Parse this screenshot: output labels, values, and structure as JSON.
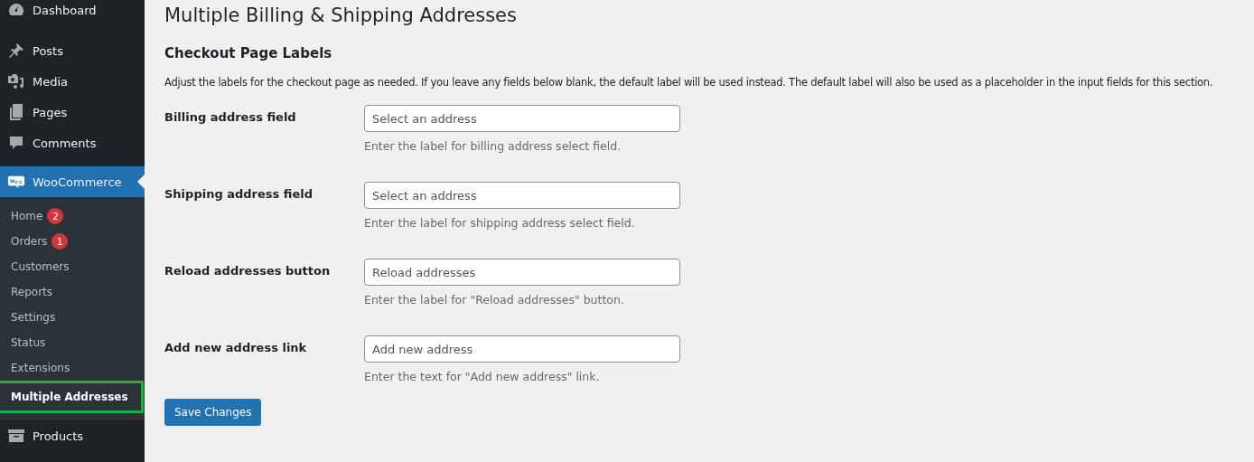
{
  "sidebar": {
    "items": [
      {
        "label": "Dashboard",
        "selected": false
      },
      {
        "label": "Posts",
        "selected": false
      },
      {
        "label": "Media",
        "selected": false
      },
      {
        "label": "Pages",
        "selected": false
      },
      {
        "label": "Comments",
        "selected": false
      },
      {
        "label": "WooCommerce",
        "selected": true,
        "children": [
          {
            "label": "Home",
            "badge": "2",
            "selected": false
          },
          {
            "label": "Orders",
            "badge": "1",
            "selected": false
          },
          {
            "label": "Customers",
            "selected": false
          },
          {
            "label": "Reports",
            "selected": false
          },
          {
            "label": "Settings",
            "selected": false
          },
          {
            "label": "Status",
            "selected": false
          },
          {
            "label": "Extensions",
            "selected": false
          },
          {
            "label": "Multiple Addresses",
            "selected": true
          }
        ]
      },
      {
        "label": "Products",
        "selected": false
      }
    ]
  },
  "page": {
    "title": "Multiple Billing & Shipping Addresses",
    "section": "Checkout Page Labels",
    "description": "Adjust the labels for the checkout page as needed. If you leave any fields below blank, the default label will be used instead. The default label will also be used as a placeholder in the input fields for this section.",
    "fields": [
      {
        "label": "Billing address field",
        "placeholder": "Select an address",
        "hint": "Enter the label for billing address select field."
      },
      {
        "label": "Shipping address field",
        "placeholder": "Select an address",
        "hint": "Enter the label for shipping address select field."
      },
      {
        "label": "Reload addresses button",
        "placeholder": "Reload addresses",
        "hint": "Enter the label for \"Reload addresses\" button."
      },
      {
        "label": "Add new address link",
        "placeholder": "Add new address",
        "hint": "Enter the text for \"Add new address\" link."
      }
    ],
    "save_button": "Save Changes"
  }
}
